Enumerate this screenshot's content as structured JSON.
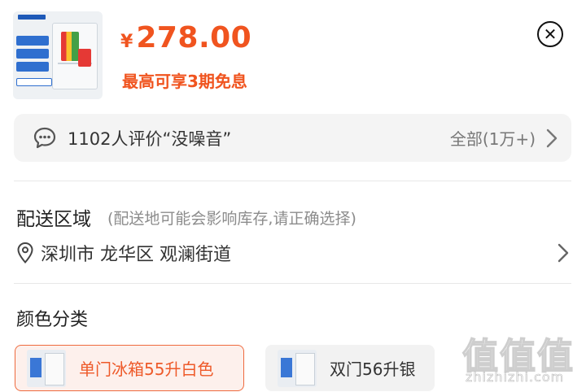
{
  "product": {
    "currency": "¥",
    "price": "278.00",
    "installment": "最高可享3期免息"
  },
  "reviews": {
    "summary": "1102人评价“没噪音”",
    "all_label": "全部(1万+)"
  },
  "delivery": {
    "title": "配送区域",
    "note": "(配送地可能会影响库存,请正确选择)",
    "address": "深圳市 龙华区 观澜街道"
  },
  "color": {
    "title": "颜色分类",
    "options": [
      {
        "label": "单门冰箱55升白色",
        "selected": true
      },
      {
        "label": "双门56升银",
        "selected": false
      }
    ]
  },
  "watermark": {
    "logo": "值值值",
    "url": "zhizhizhi.com"
  },
  "colors": {
    "accent": "#f0541f",
    "selected_border": "#ee6a3e",
    "selected_bg": "#fdf0ec",
    "panel_bg": "#f4f4f4"
  },
  "icons": {
    "close": "close-icon",
    "chat": "chat-bubble-icon",
    "location": "location-pin-icon",
    "chevron": "chevron-right-icon"
  }
}
